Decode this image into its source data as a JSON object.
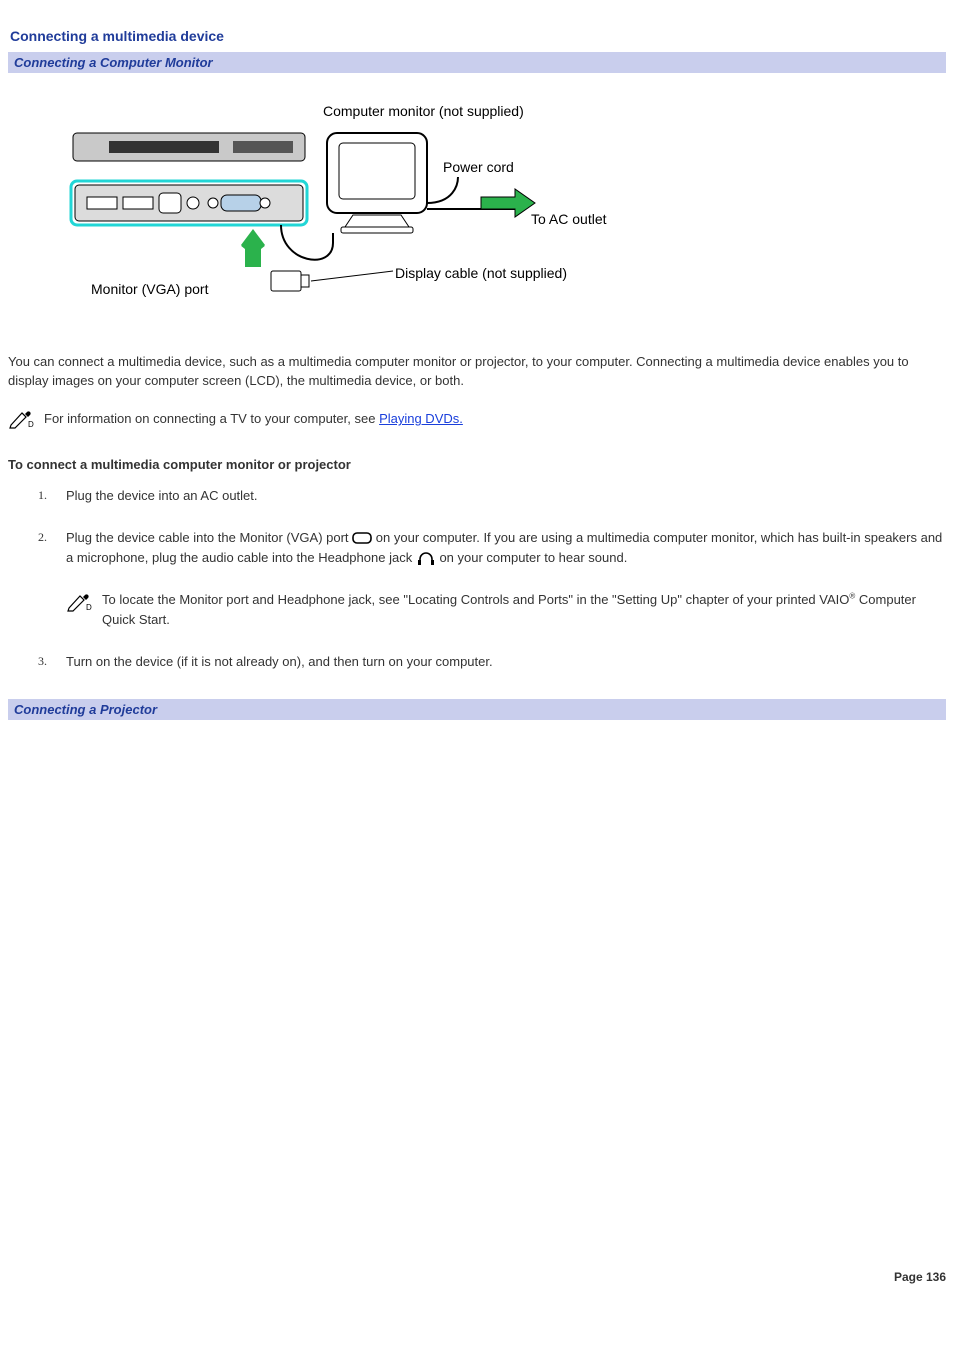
{
  "title": "Connecting a multimedia device",
  "section1": "Connecting a Computer Monitor",
  "diagram": {
    "monitor_label": "Computer monitor (not supplied)",
    "power_cord": "Power cord",
    "ac_outlet": "To AC outlet",
    "display_cable": "Display cable (not supplied)",
    "vga_port": "Monitor (VGA) port"
  },
  "intro": "You can connect a multimedia device, such as a multimedia computer monitor or projector, to your computer. Connecting a multimedia device enables you to display images on your computer screen (LCD), the multimedia device, or both.",
  "note1_prefix": "For information on connecting a TV to your computer, see ",
  "note1_link": "Playing DVDs.",
  "heading2": "To connect a multimedia computer monitor or projector",
  "steps": {
    "s1": "Plug the device into an AC outlet.",
    "s2a": "Plug the device cable into the Monitor (VGA) port ",
    "s2b": "on your computer. If you are using a multimedia computer monitor, which has built-in speakers and a microphone, plug the audio cable into the Headphone jack ",
    "s2c": "on your computer to hear sound.",
    "s2note_a": "To locate the Monitor port and Headphone jack, see \"Locating Controls and Ports\" in the \"Setting Up\" chapter of your printed VAIO",
    "s2note_b": " Computer Quick Start.",
    "s3": "Turn on the device (if it is not already on), and then turn on your computer."
  },
  "section2": "Connecting a Projector",
  "footer": "Page 136"
}
